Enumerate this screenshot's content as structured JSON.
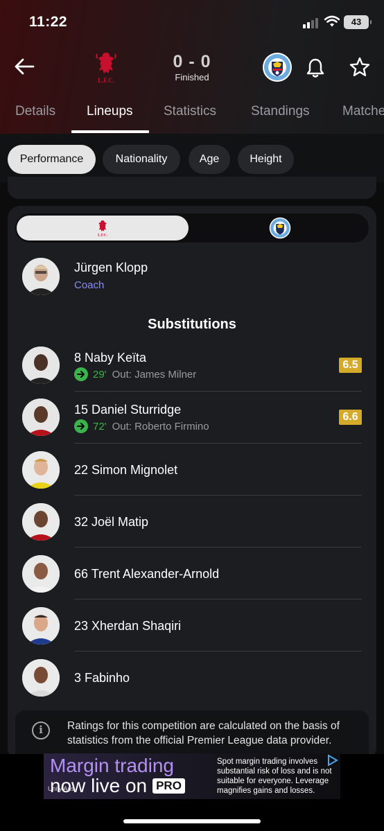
{
  "status_bar": {
    "time": "11:22",
    "battery": "43"
  },
  "match": {
    "score": "0 - 0",
    "status": "Finished",
    "home_team": "Liverpool",
    "away_team": "Manchester City",
    "home_logo_text": "LFC",
    "away_logo_text": "MANCHESTER CITY"
  },
  "tabs": [
    {
      "label": "Details"
    },
    {
      "label": "Lineups"
    },
    {
      "label": "Statistics"
    },
    {
      "label": "Standings"
    },
    {
      "label": "Matches"
    }
  ],
  "active_tab": "Lineups",
  "filters": [
    {
      "label": "Performance"
    },
    {
      "label": "Nationality"
    },
    {
      "label": "Age"
    },
    {
      "label": "Height"
    }
  ],
  "active_filter": "Performance",
  "coach": {
    "name": "Jürgen Klopp",
    "role": "Coach"
  },
  "substitutions_title": "Substitutions",
  "substitutes": [
    {
      "name": "8 Naby Keïta",
      "minute": "29'",
      "out": "Out: James Milner",
      "rating": "6.5"
    },
    {
      "name": "15 Daniel Sturridge",
      "minute": "72'",
      "out": "Out: Roberto Firmino",
      "rating": "6.6"
    },
    {
      "name": "22 Simon Mignolet"
    },
    {
      "name": "32 Joël Matip"
    },
    {
      "name": "66 Trent Alexander-Arnold"
    },
    {
      "name": "23 Xherdan Shaqiri"
    },
    {
      "name": "3 Fabinho"
    }
  ],
  "info_note": "Ratings for this competition are calculated on the basis of statistics from the official Premier League data provider.",
  "ad": {
    "headline": "Margin trading",
    "subline": "now live on",
    "brand": "PRO",
    "disclaimer": "Spot margin trading involves substantial risk of loss and is not suitable for everyone. Leverage magnifies gains and losses.",
    "network": "Unity Ads"
  },
  "colors": {
    "accent_purple": "#8a8cf5",
    "sub_in_green": "#3ab44a",
    "rating_gold": "#d4aa2a",
    "lfc_red": "#c8102e",
    "mci_blue": "#6cabdd"
  }
}
